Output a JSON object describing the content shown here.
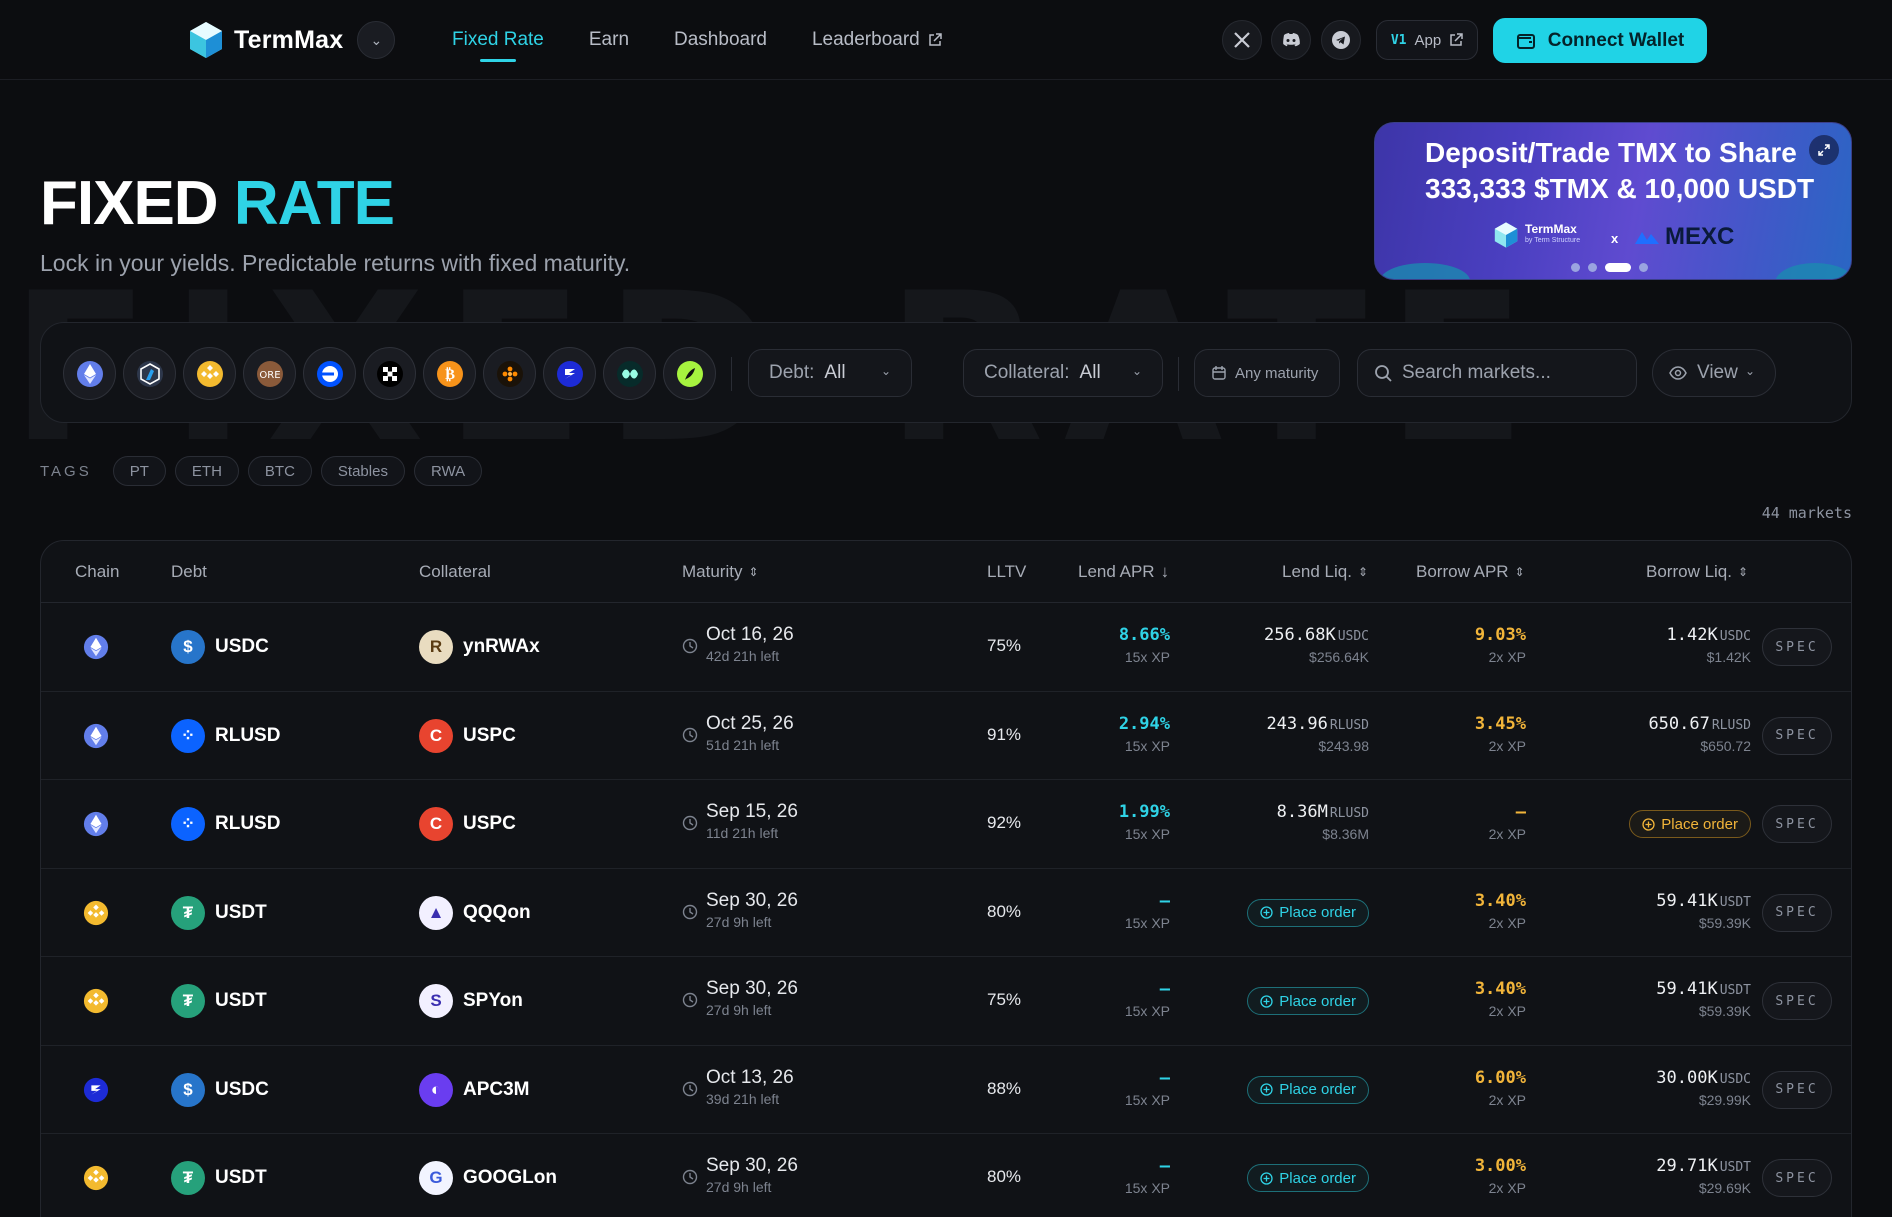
{
  "app": {
    "name": "TermMax",
    "nav": [
      {
        "label": "Fixed Rate",
        "active": true
      },
      {
        "label": "Earn",
        "active": false
      },
      {
        "label": "Dashboard",
        "active": false
      },
      {
        "label": "Leaderboard",
        "active": false
      }
    ],
    "socials": [
      "x-icon",
      "discord-icon",
      "telegram-icon"
    ],
    "app_badge": {
      "version": "V1",
      "label": "App"
    },
    "connect_label": "Connect Wallet",
    "accent": "#20d3e6"
  },
  "hero": {
    "title_main": "FIXED",
    "title_accent": "RATE",
    "subtitle": "Lock in your yields. Predictable returns with fixed maturity."
  },
  "banner": {
    "line1": "Deposit/Trade TMX to Share",
    "line2": "333,333 $TMX & 10,000 USDT",
    "brand": "TermMax",
    "brand_sub": "by Term Structure",
    "x": "x",
    "partner": "MEXC",
    "active_slide": 3,
    "slides": 4
  },
  "filters": {
    "chains": [
      "ethereum-icon",
      "arbitrum-icon",
      "bnb-icon",
      "mantle-icon",
      "base-icon",
      "okx-icon",
      "bitcoin-icon",
      "berachain-icon",
      "sonic-icon",
      "hyperliquid-icon",
      "plume-icon"
    ],
    "debt": {
      "label": "Debt:",
      "value": "All"
    },
    "collateral": {
      "label": "Collateral:",
      "value": "All"
    },
    "maturity": "Any maturity",
    "search_placeholder": "Search markets...",
    "view": "View"
  },
  "tags": {
    "label": "TAGS",
    "items": [
      "PT",
      "ETH",
      "BTC",
      "Stables",
      "RWA"
    ]
  },
  "markets_count": "44 markets",
  "table": {
    "headers": {
      "chain": "Chain",
      "debt": "Debt",
      "collateral": "Collateral",
      "maturity": "Maturity",
      "lltv": "LLTV",
      "lend_apr": "Lend APR",
      "lend_liq": "Lend Liq.",
      "borrow_apr": "Borrow APR",
      "borrow_liq": "Borrow Liq."
    },
    "place_order": "Place order",
    "spec": "SPEC",
    "rows": [
      {
        "chain": "ethereum",
        "debt": "USDC",
        "collateral": "ynRWAx",
        "date": "Oct 16, 26",
        "left": "42d 21h left",
        "lltv": "75%",
        "lend_apr": "8.66%",
        "lend_xp": "15x XP",
        "lend_liq": "256.68K",
        "lend_unit": "USDC",
        "lend_usd": "$256.64K",
        "borrow_apr": "9.03%",
        "borrow_xp": "2x XP",
        "borrow_liq": "1.42K",
        "borrow_unit": "USDC",
        "borrow_usd": "$1.42K"
      },
      {
        "chain": "ethereum",
        "debt": "RLUSD",
        "collateral": "USPC",
        "date": "Oct 25, 26",
        "left": "51d 21h left",
        "lltv": "91%",
        "lend_apr": "2.94%",
        "lend_xp": "15x XP",
        "lend_liq": "243.96",
        "lend_unit": "RLUSD",
        "lend_usd": "$243.98",
        "borrow_apr": "3.45%",
        "borrow_xp": "2x XP",
        "borrow_liq": "650.67",
        "borrow_unit": "RLUSD",
        "borrow_usd": "$650.72"
      },
      {
        "chain": "ethereum",
        "debt": "RLUSD",
        "collateral": "USPC",
        "date": "Sep 15, 26",
        "left": "11d 21h left",
        "lltv": "92%",
        "lend_apr": "1.99%",
        "lend_xp": "15x XP",
        "lend_liq": "8.36M",
        "lend_unit": "RLUSD",
        "lend_usd": "$8.36M",
        "borrow_apr": "–",
        "borrow_xp": "2x XP",
        "borrow_liq": null,
        "borrow_unit": null,
        "borrow_usd": null
      },
      {
        "chain": "bnb",
        "debt": "USDT",
        "collateral": "QQQon",
        "date": "Sep 30, 26",
        "left": "27d 9h left",
        "lltv": "80%",
        "lend_apr": "–",
        "lend_xp": "15x XP",
        "lend_liq": null,
        "lend_unit": null,
        "lend_usd": null,
        "borrow_apr": "3.40%",
        "borrow_xp": "2x XP",
        "borrow_liq": "59.41K",
        "borrow_unit": "USDT",
        "borrow_usd": "$59.39K"
      },
      {
        "chain": "bnb",
        "debt": "USDT",
        "collateral": "SPYon",
        "date": "Sep 30, 26",
        "left": "27d 9h left",
        "lltv": "75%",
        "lend_apr": "–",
        "lend_xp": "15x XP",
        "lend_liq": null,
        "lend_unit": null,
        "lend_usd": null,
        "borrow_apr": "3.40%",
        "borrow_xp": "2x XP",
        "borrow_liq": "59.41K",
        "borrow_unit": "USDT",
        "borrow_usd": "$59.39K"
      },
      {
        "chain": "sonic",
        "debt": "USDC",
        "collateral": "APC3M",
        "date": "Oct 13, 26",
        "left": "39d 21h left",
        "lltv": "88%",
        "lend_apr": "–",
        "lend_xp": "15x XP",
        "lend_liq": null,
        "lend_unit": null,
        "lend_usd": null,
        "borrow_apr": "6.00%",
        "borrow_xp": "2x XP",
        "borrow_liq": "30.00K",
        "borrow_unit": "USDC",
        "borrow_usd": "$29.99K"
      },
      {
        "chain": "bnb",
        "debt": "USDT",
        "collateral": "GOOGLon",
        "date": "Sep 30, 26",
        "left": "27d 9h left",
        "lltv": "80%",
        "lend_apr": "–",
        "lend_xp": "15x XP",
        "lend_liq": null,
        "lend_unit": null,
        "lend_usd": null,
        "borrow_apr": "3.00%",
        "borrow_xp": "2x XP",
        "borrow_liq": "29.71K",
        "borrow_unit": "USDT",
        "borrow_usd": "$29.69K"
      }
    ]
  }
}
